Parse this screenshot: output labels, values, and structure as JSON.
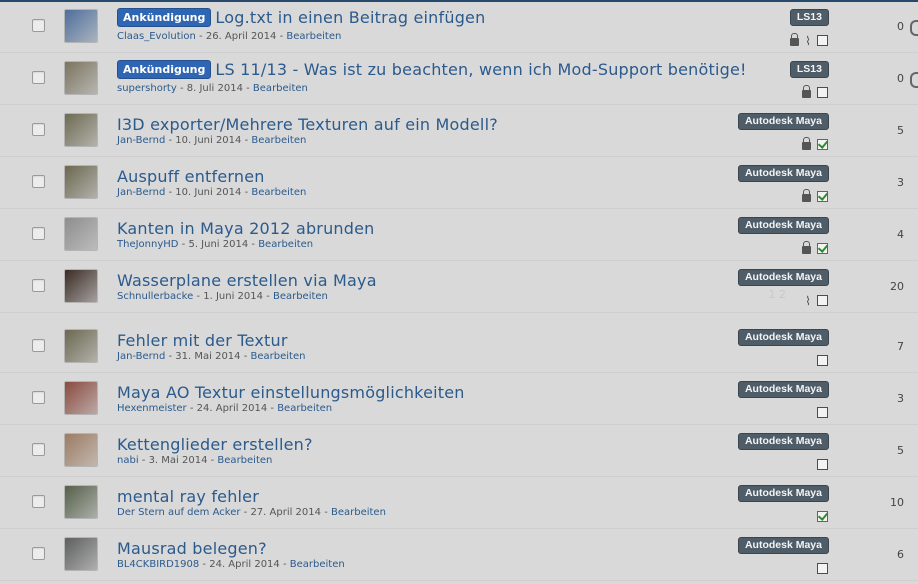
{
  "announcement_label": "Ankündigung",
  "separator": " - ",
  "edit_label": "Bearbeiten",
  "threads": [
    {
      "title": "Log.txt in einen Beitrag einfügen",
      "announcement": true,
      "author": "Claas_Evolution",
      "date": "26. April 2014",
      "label": "LS13",
      "icons": [
        "lock-icon",
        "attachment-icon",
        "unread-icon"
      ],
      "count": "0",
      "avatar_color": "#4e6e9a"
    },
    {
      "title": "LS 11/13 - Was ist zu beachten, wenn ich Mod-Support benötige!",
      "announcement": true,
      "author": "supershorty",
      "date": "8. Juli 2014",
      "label": "LS13",
      "icons": [
        "lock-icon",
        "unread-icon"
      ],
      "count": "0",
      "avatar_color": "#7b7460"
    },
    {
      "title": "I3D exporter/Mehrere Texturen auf ein Modell?",
      "announcement": false,
      "author": "Jan-Bernd",
      "date": "10. Juni 2014",
      "label": "Autodesk Maya",
      "icons": [
        "lock-icon",
        "solved-icon"
      ],
      "count": "5",
      "avatar_color": "#6e6a52"
    },
    {
      "title": "Auspuff entfernen",
      "announcement": false,
      "author": "Jan-Bernd",
      "date": "10. Juni 2014",
      "label": "Autodesk Maya",
      "icons": [
        "lock-icon",
        "solved-icon"
      ],
      "count": "3",
      "avatar_color": "#6b6750"
    },
    {
      "title": "Kanten in Maya 2012 abrunden",
      "announcement": false,
      "author": "TheJonnyHD",
      "date": "5. Juni 2014",
      "label": "Autodesk Maya",
      "icons": [
        "lock-icon",
        "solved-icon"
      ],
      "count": "4",
      "avatar_color": "#8d8d8d"
    },
    {
      "title": "Wasserplane erstellen via Maya",
      "announcement": false,
      "author": "Schnullerbacke",
      "date": "1. Juni 2014",
      "label": "Autodesk Maya",
      "icons": [
        "attachment-icon",
        "unread-icon"
      ],
      "pages": "1 2",
      "count": "20",
      "avatar_color": "#3b2b25"
    },
    {
      "title": "Fehler mit der Textur",
      "announcement": false,
      "author": "Jan-Bernd",
      "date": "31. Mai 2014",
      "label": "Autodesk Maya",
      "icons": [
        "unread-icon"
      ],
      "count": "7",
      "avatar_color": "#6b6750"
    },
    {
      "title": "Maya AO Textur einstellungsmöglichkeiten",
      "announcement": false,
      "author": "Hexenmeister",
      "date": "24. April 2014",
      "label": "Autodesk Maya",
      "icons": [
        "unread-icon"
      ],
      "count": "3",
      "avatar_color": "#8a4a3e"
    },
    {
      "title": "Kettenglieder erstellen?",
      "announcement": false,
      "author": "nabi",
      "date": "3. Mai 2014",
      "label": "Autodesk Maya",
      "icons": [
        "unread-icon"
      ],
      "count": "5",
      "avatar_color": "#9d7b62"
    },
    {
      "title": "mental ray fehler",
      "announcement": false,
      "author": "Der Stern auf dem Acker",
      "date": "27. April 2014",
      "label": "Autodesk Maya",
      "icons": [
        "solved-icon"
      ],
      "count": "10",
      "avatar_color": "#55604a"
    },
    {
      "title": "Mausrad belegen?",
      "announcement": false,
      "author": "BL4CKBIRD1908",
      "date": "24. April 2014",
      "label": "Autodesk Maya",
      "icons": [
        "unread-icon"
      ],
      "count": "6",
      "avatar_color": "#5d5f5e"
    }
  ]
}
